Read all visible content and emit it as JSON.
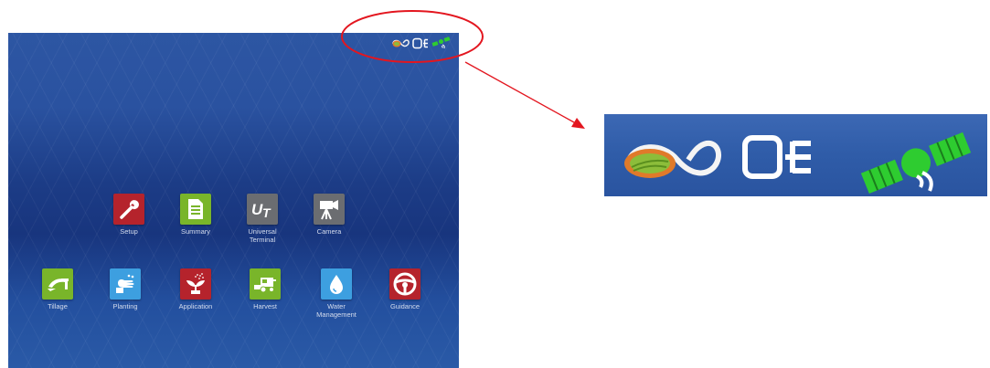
{
  "apps": [
    {
      "id": "setup",
      "label": "Setup",
      "icon": "wrench-icon",
      "color": "#b5232c"
    },
    {
      "id": "summary",
      "label": "Summary",
      "icon": "document-icon",
      "color": "#79b52a"
    },
    {
      "id": "universal-terminal",
      "label": "Universal\nTerminal",
      "icon": "ut-icon",
      "color": "#6b6d71"
    },
    {
      "id": "camera",
      "label": "Camera",
      "icon": "camera-icon",
      "color": "#6b6d71"
    },
    {
      "id": "tillage",
      "label": "Tillage",
      "icon": "plow-icon",
      "color": "#79b52a"
    },
    {
      "id": "planting",
      "label": "Planting",
      "icon": "seed-hand-icon",
      "color": "#3d9fe0"
    },
    {
      "id": "application",
      "label": "Application",
      "icon": "plant-spray-icon",
      "color": "#b5232c"
    },
    {
      "id": "harvest",
      "label": "Harvest",
      "icon": "combine-icon",
      "color": "#79b52a"
    },
    {
      "id": "water-management",
      "label": "Water\nManagement",
      "icon": "water-drop-icon",
      "color": "#3d9fe0"
    },
    {
      "id": "guidance",
      "label": "Guidance",
      "icon": "steering-wheel-icon",
      "color": "#b5232c"
    }
  ],
  "status_icons": [
    "infinity-icon",
    "can-bus-icon",
    "gps-satellite-icon"
  ],
  "callout": {
    "ellipse_color": "#e3161f",
    "arrow_color": "#e3161f"
  }
}
